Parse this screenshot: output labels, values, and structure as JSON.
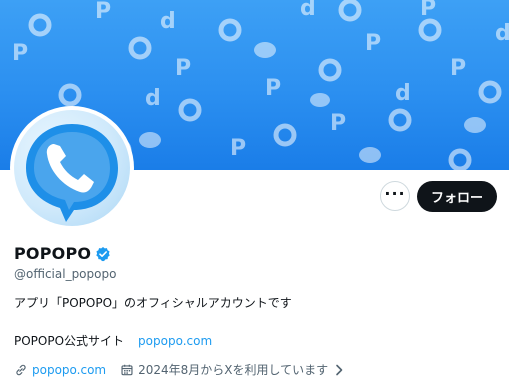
{
  "profile": {
    "display_name": "POPOPO",
    "handle": "@official_popopo",
    "bio": "アプリ「POPOPO」のオフィシャルアカウントです",
    "website_label": "POPOPO公式サイト",
    "website_link": "popopo.com",
    "meta_link": "popopo.com",
    "joined": "2024年8月からXを利用しています"
  },
  "actions": {
    "more_label": "···",
    "follow_label": "フォロー"
  },
  "icons": {
    "verified": "verified-badge-icon",
    "link": "link-icon",
    "calendar": "calendar-icon",
    "chevron": "chevron-right-icon",
    "more": "more-icon",
    "avatar": "phone-bubble-logo"
  },
  "colors": {
    "banner": "#2b8ff0",
    "link": "#1d9bf0",
    "follow_bg": "#0f1419",
    "verified": "#1d9bf0"
  }
}
